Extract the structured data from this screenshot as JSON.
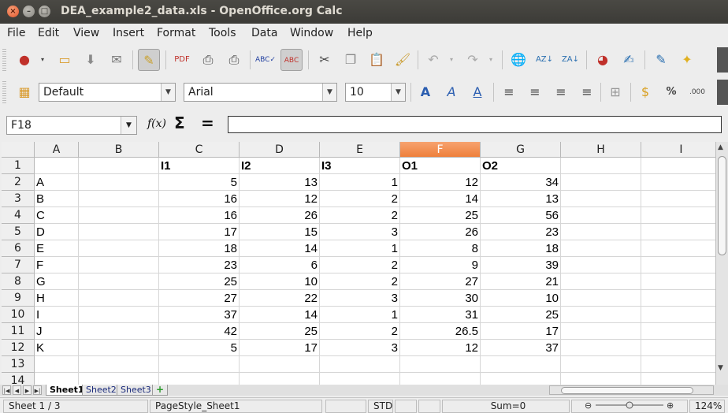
{
  "window": {
    "title": "DEA_example2_data.xls - OpenOffice.org Calc"
  },
  "menu": [
    "File",
    "Edit",
    "View",
    "Insert",
    "Format",
    "Tools",
    "Data",
    "Window",
    "Help"
  ],
  "formatting": {
    "style": "Default",
    "font": "Arial",
    "size": "10",
    "percent_label": "%",
    "decimal_label": ".000"
  },
  "formula_bar": {
    "cell_ref": "F18",
    "function_icon": "f(x)",
    "sum_icon": "Σ",
    "equals_icon": "=",
    "content": ""
  },
  "spreadsheet": {
    "selected_column": "F",
    "columns": [
      "A",
      "B",
      "C",
      "D",
      "E",
      "F",
      "G",
      "H",
      "I"
    ],
    "row_numbers": [
      "1",
      "2",
      "3",
      "4",
      "5",
      "6",
      "7",
      "8",
      "9",
      "10",
      "11",
      "12",
      "13",
      "14"
    ],
    "rows": [
      [
        "",
        "",
        "I1",
        "I2",
        "I3",
        "O1",
        "O2",
        "",
        ""
      ],
      [
        "A",
        "",
        "5",
        "13",
        "1",
        "12",
        "34",
        "",
        ""
      ],
      [
        "B",
        "",
        "16",
        "12",
        "2",
        "14",
        "13",
        "",
        ""
      ],
      [
        "C",
        "",
        "16",
        "26",
        "2",
        "25",
        "56",
        "",
        ""
      ],
      [
        "D",
        "",
        "17",
        "15",
        "3",
        "26",
        "23",
        "",
        ""
      ],
      [
        "E",
        "",
        "18",
        "14",
        "1",
        "8",
        "18",
        "",
        ""
      ],
      [
        "F",
        "",
        "23",
        "6",
        "2",
        "9",
        "39",
        "",
        ""
      ],
      [
        "G",
        "",
        "25",
        "10",
        "2",
        "27",
        "21",
        "",
        ""
      ],
      [
        "H",
        "",
        "27",
        "22",
        "3",
        "30",
        "10",
        "",
        ""
      ],
      [
        "I",
        "",
        "37",
        "14",
        "1",
        "31",
        "25",
        "",
        ""
      ],
      [
        "J",
        "",
        "42",
        "25",
        "2",
        "26.5",
        "17",
        "",
        ""
      ],
      [
        "K",
        "",
        "5",
        "17",
        "3",
        "12",
        "37",
        "",
        ""
      ],
      [
        "",
        "",
        "",
        "",
        "",
        "",
        "",
        "",
        ""
      ],
      [
        "",
        "",
        "",
        "",
        "",
        "",
        "",
        "",
        ""
      ]
    ]
  },
  "sheet_tabs": {
    "tabs": [
      "Sheet1",
      "Sheet2",
      "Sheet3"
    ],
    "active": "Sheet1"
  },
  "status": {
    "sheet": "Sheet 1 / 3",
    "page_style": "PageStyle_Sheet1",
    "mode": "STD",
    "sum": "Sum=0",
    "zoom": "124%",
    "zoom_level_fraction": 0.5
  },
  "colors": {
    "selected_column_header": "#ee7f3b",
    "title_bar": "#3c3b37",
    "close_button": "#e2532a"
  }
}
